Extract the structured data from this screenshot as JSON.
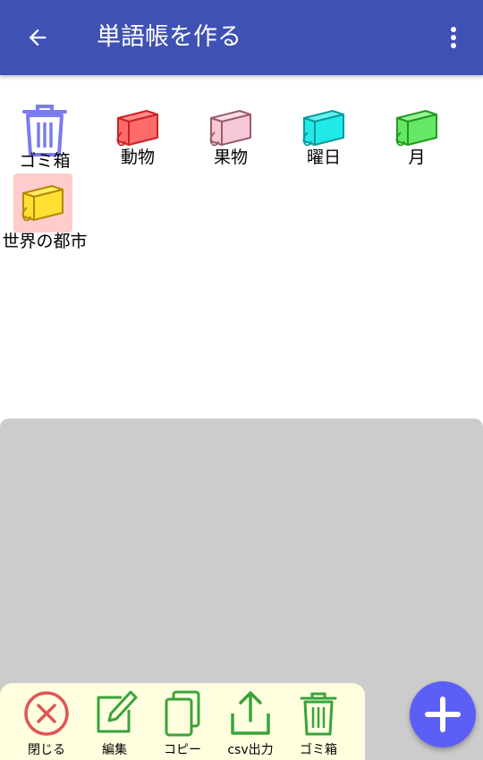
{
  "appbar": {
    "title": "単語帳を作る",
    "background": "#3f51b5",
    "back_icon": "arrow-left-icon",
    "menu_icon": "more-vert-icon"
  },
  "books": [
    {
      "label": "ゴミ箱",
      "icon": "trash-icon",
      "color": "#7b7bf0"
    },
    {
      "label": "動物",
      "icon": "notebook-icon",
      "color": "#ff6b6b"
    },
    {
      "label": "果物",
      "icon": "notebook-icon",
      "color": "#f5c9d6"
    },
    {
      "label": "曜日",
      "icon": "notebook-icon",
      "color": "#22e8e8"
    },
    {
      "label": "月",
      "icon": "notebook-icon",
      "color": "#66e866"
    },
    {
      "label": "世界の都市",
      "icon": "notebook-icon",
      "color": "#ffe033",
      "selected": true
    }
  ],
  "toolbar": {
    "items": [
      {
        "label": "閉じる",
        "icon": "close-circle-icon",
        "color": "#e05555"
      },
      {
        "label": "編集",
        "icon": "edit-icon",
        "color": "#3aa33a"
      },
      {
        "label": "コピー",
        "icon": "copy-icon",
        "color": "#3aa33a"
      },
      {
        "label": "csv出力",
        "icon": "share-export-icon",
        "color": "#3aa33a"
      },
      {
        "label": "ゴミ箱",
        "icon": "trash-icon",
        "color": "#3aa33a"
      }
    ],
    "background": "#ffffe0"
  },
  "fab": {
    "icon": "plus-icon",
    "color": "#5b5ff5"
  },
  "panel": {
    "color": "#cccccc"
  },
  "selection_highlight": "#ffcccc"
}
